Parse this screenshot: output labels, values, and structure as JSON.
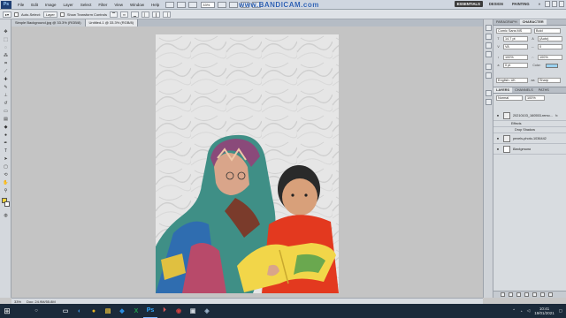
{
  "menubar": {
    "app_badge": "Ps",
    "items": [
      "File",
      "Edit",
      "Image",
      "Layer",
      "Select",
      "Filter",
      "View",
      "Window",
      "Help"
    ],
    "zoom": "33%",
    "watermark": "www.BANDICAM.com",
    "workspaces": [
      "ESSENTIALS",
      "DESIGN",
      "PAINTING"
    ],
    "more": "»"
  },
  "options": {
    "auto_select_label": "Auto-Select:",
    "auto_select_value": "Layer",
    "transform_label": "Show Transform Controls"
  },
  "tabs": [
    {
      "label": "Simple Background.jpg @ 33.3% (RGB/8)",
      "active": false
    },
    {
      "label": "Untitled-1 @ 33.3% (RGB/8)",
      "active": true
    }
  ],
  "status": {
    "zoom": "33%",
    "doc": "Doc: 24.9M/55.8M"
  },
  "character": {
    "tabs": [
      "PARAGRAPH",
      "CHARACTER"
    ],
    "font_family": "Comic Sans MS",
    "font_style": "Bold",
    "font_size": "14.7 pt",
    "leading": "(Auto)",
    "kerning": "VA",
    "tracking": "0",
    "vscale": "100%",
    "hscale": "100%",
    "baseline": "0 pt",
    "color_label": "Color:",
    "color_hex": "#9ad1f0",
    "language": "English: UK",
    "antialias": "Sharp"
  },
  "layers": {
    "tabs": [
      "LAYERS",
      "CHANNELS",
      "PATHS"
    ],
    "blend": "Normal",
    "opacity": "100%",
    "items": [
      {
        "name": "20210103_160553-remo...",
        "eye": "●",
        "selected": false,
        "has_fx": true
      },
      {
        "name": "Effects",
        "eye": "",
        "selected": false,
        "sub": true
      },
      {
        "name": "Drop Shadow",
        "eye": "",
        "selected": false,
        "sub": true
      },
      {
        "name": "pexels-photo-1036442",
        "eye": "●",
        "selected": false
      },
      {
        "name": "Background",
        "eye": "●",
        "selected": false
      }
    ]
  },
  "taskbar": {
    "start": "⊞",
    "search": "○",
    "apps": [
      "▭",
      "◐",
      "●",
      "▤",
      "◆",
      "X",
      "Ps",
      "⏵",
      "◉",
      "▣",
      "◈"
    ],
    "time": "10:41",
    "date": "19/01/2021"
  }
}
